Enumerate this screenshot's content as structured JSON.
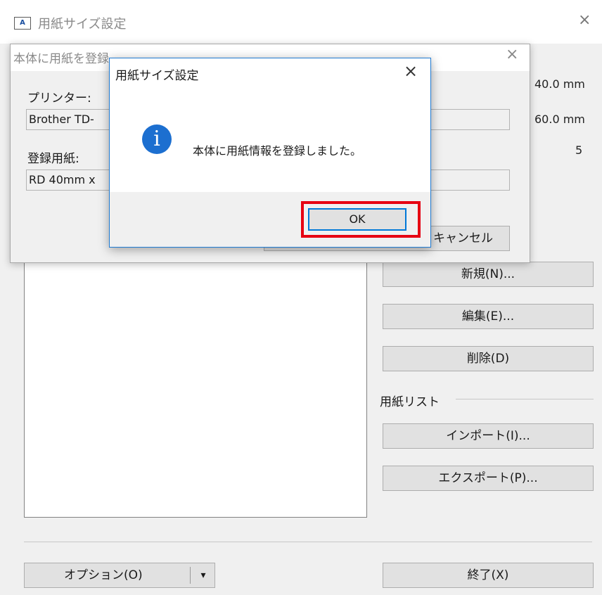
{
  "main_window": {
    "title": "用紙サイズ設定",
    "app_icon_text": "A",
    "close_glyph": "×",
    "values": [
      "40.0 mm",
      "60.0 mm",
      "5"
    ],
    "buttons": {
      "new": "新規(N)...",
      "edit": "編集(E)...",
      "delete": "削除(D)",
      "import": "インポート(I)...",
      "export": "エクスポート(P)...",
      "option": "オプション(O)",
      "option_dropdown": "▾",
      "exit": "終了(X)"
    },
    "paper_list_label": "用紙リスト"
  },
  "register_dialog": {
    "title": "本体に用紙を登録",
    "close_glyph": "×",
    "printer_label": "プリンター:",
    "printer_value": "Brother TD-",
    "paper_label": "登録用紙:",
    "paper_value": "RD 40mm x",
    "cancel_label": "キャンセル"
  },
  "message_dialog": {
    "title": "用紙サイズ設定",
    "close_glyph": "×",
    "icon_glyph": "i",
    "message": "本体に用紙情報を登録しました。",
    "ok_label": "OK"
  },
  "colors": {
    "highlight": "#e60012",
    "info_icon": "#1c6fd0",
    "dialog_border": "#1f7ad1"
  }
}
